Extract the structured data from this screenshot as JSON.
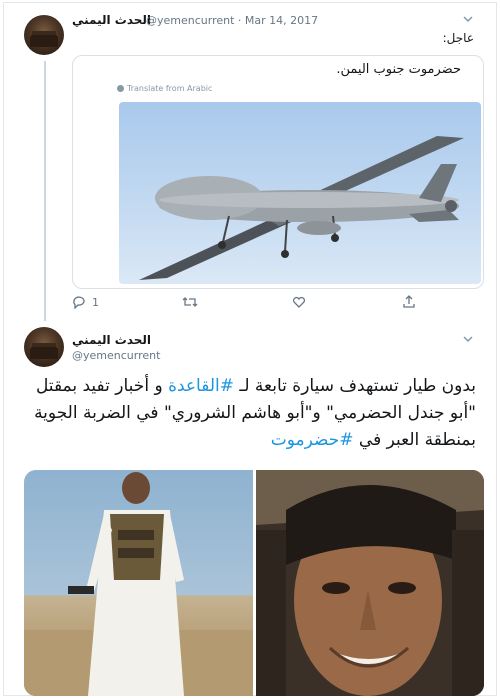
{
  "tweet1": {
    "name": "الحدث اليمني",
    "handle_date": "@yemencurrent · Mar 14, 2017",
    "label": "عاجل:",
    "quote": {
      "text": "حضرموت جنوب اليمن.",
      "translate": "Translate from Arabic"
    },
    "actions": {
      "reply_count": "1"
    }
  },
  "tweet2": {
    "name": "الحدث اليمني",
    "handle": "@yemencurrent",
    "body": {
      "part1": "بدون طيار تستهدف سيارة  تابعة لـ ",
      "hashtag1": "#القاعدة",
      "part2": " و أخبار تفيد بمقتل \"أبو جندل الحضرمي\" و\"أبو هاشم الشروري\" في الضربة الجوية بمنطقة العبر في ",
      "hashtag2": "#حضرموت"
    }
  },
  "icons": {
    "reply": "reply-icon",
    "retweet": "retweet-icon",
    "like": "heart-icon",
    "share": "share-icon",
    "chevron": "chevron-down-icon"
  },
  "colors": {
    "hashtag": "#1b95e0",
    "secondary": "#657786",
    "border": "#e1e8ed"
  }
}
